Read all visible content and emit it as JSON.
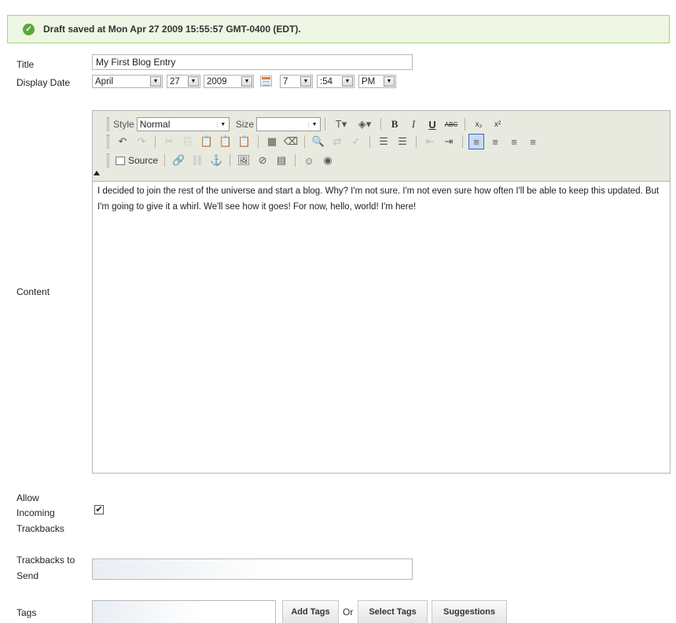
{
  "alert": {
    "message": "Draft saved at Mon Apr 27 2009 15:55:57 GMT-0400 (EDT).",
    "icon": "check-circle-icon",
    "colors": {
      "background": "#eef7e3",
      "border": "#a8cf84",
      "icon": "#5ba83b"
    }
  },
  "form": {
    "title": {
      "label": "Title",
      "value": "My First Blog Entry"
    },
    "display_date": {
      "label": "Display Date",
      "month": "April",
      "day": "27",
      "year": "2009",
      "hour": "7",
      "minute": ":54",
      "ampm": "PM"
    },
    "content": {
      "label": "Content",
      "text": "I decided to join the rest of the universe and start a blog. Why? I'm not sure. I'm not even sure how often I'll be able to keep this updated. But I'm going to give it a whirl. We'll see how it goes! For now, hello, world! I'm here!"
    },
    "trackbacks": {
      "label_line1": "Allow",
      "label_line2": "Incoming",
      "label_line3": "Trackbacks",
      "checked": true,
      "check_mark": "✔"
    },
    "trackbacks_send": {
      "label_line1": "Trackbacks to",
      "label_line2": "Send",
      "value": ""
    },
    "tags": {
      "label": "Tags",
      "value": "",
      "add_button": "Add Tags",
      "or_text": "Or",
      "select_button": "Select Tags",
      "suggestions_button": "Suggestions"
    }
  },
  "editor": {
    "style_label": "Style",
    "style_value": "Normal",
    "size_label": "Size",
    "size_value": "",
    "source_label": "Source",
    "active_alignment": "left",
    "active_color": "#c9daf1"
  }
}
